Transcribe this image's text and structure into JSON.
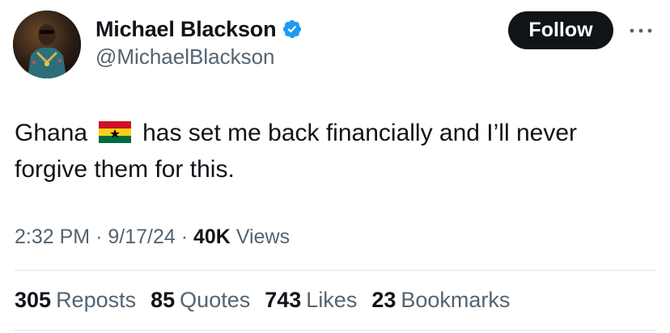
{
  "author": {
    "display_name": "Michael Blackson",
    "handle": "@MichaelBlackson",
    "verified": true,
    "verified_color": "#1d9bf0"
  },
  "follow_button": {
    "label": "Follow"
  },
  "more_icon": "more-horizontal-icon",
  "tweet": {
    "text_before_flag": "Ghana",
    "flag": "ghana-flag-icon",
    "text_after_flag": "has set me back financially and I’ll never forgive them for this."
  },
  "meta": {
    "time": "2:32 PM",
    "separator": "·",
    "date": "9/17/24",
    "views_count": "40K",
    "views_label": "Views"
  },
  "stats": {
    "reposts_count": "305",
    "reposts_label": "Reposts",
    "quotes_count": "85",
    "quotes_label": "Quotes",
    "likes_count": "743",
    "likes_label": "Likes",
    "bookmarks_count": "23",
    "bookmarks_label": "Bookmarks"
  },
  "colors": {
    "text_primary": "#0f1419",
    "text_secondary": "#536471",
    "divider": "#dfe4e8",
    "button_bg": "#0f1419"
  }
}
